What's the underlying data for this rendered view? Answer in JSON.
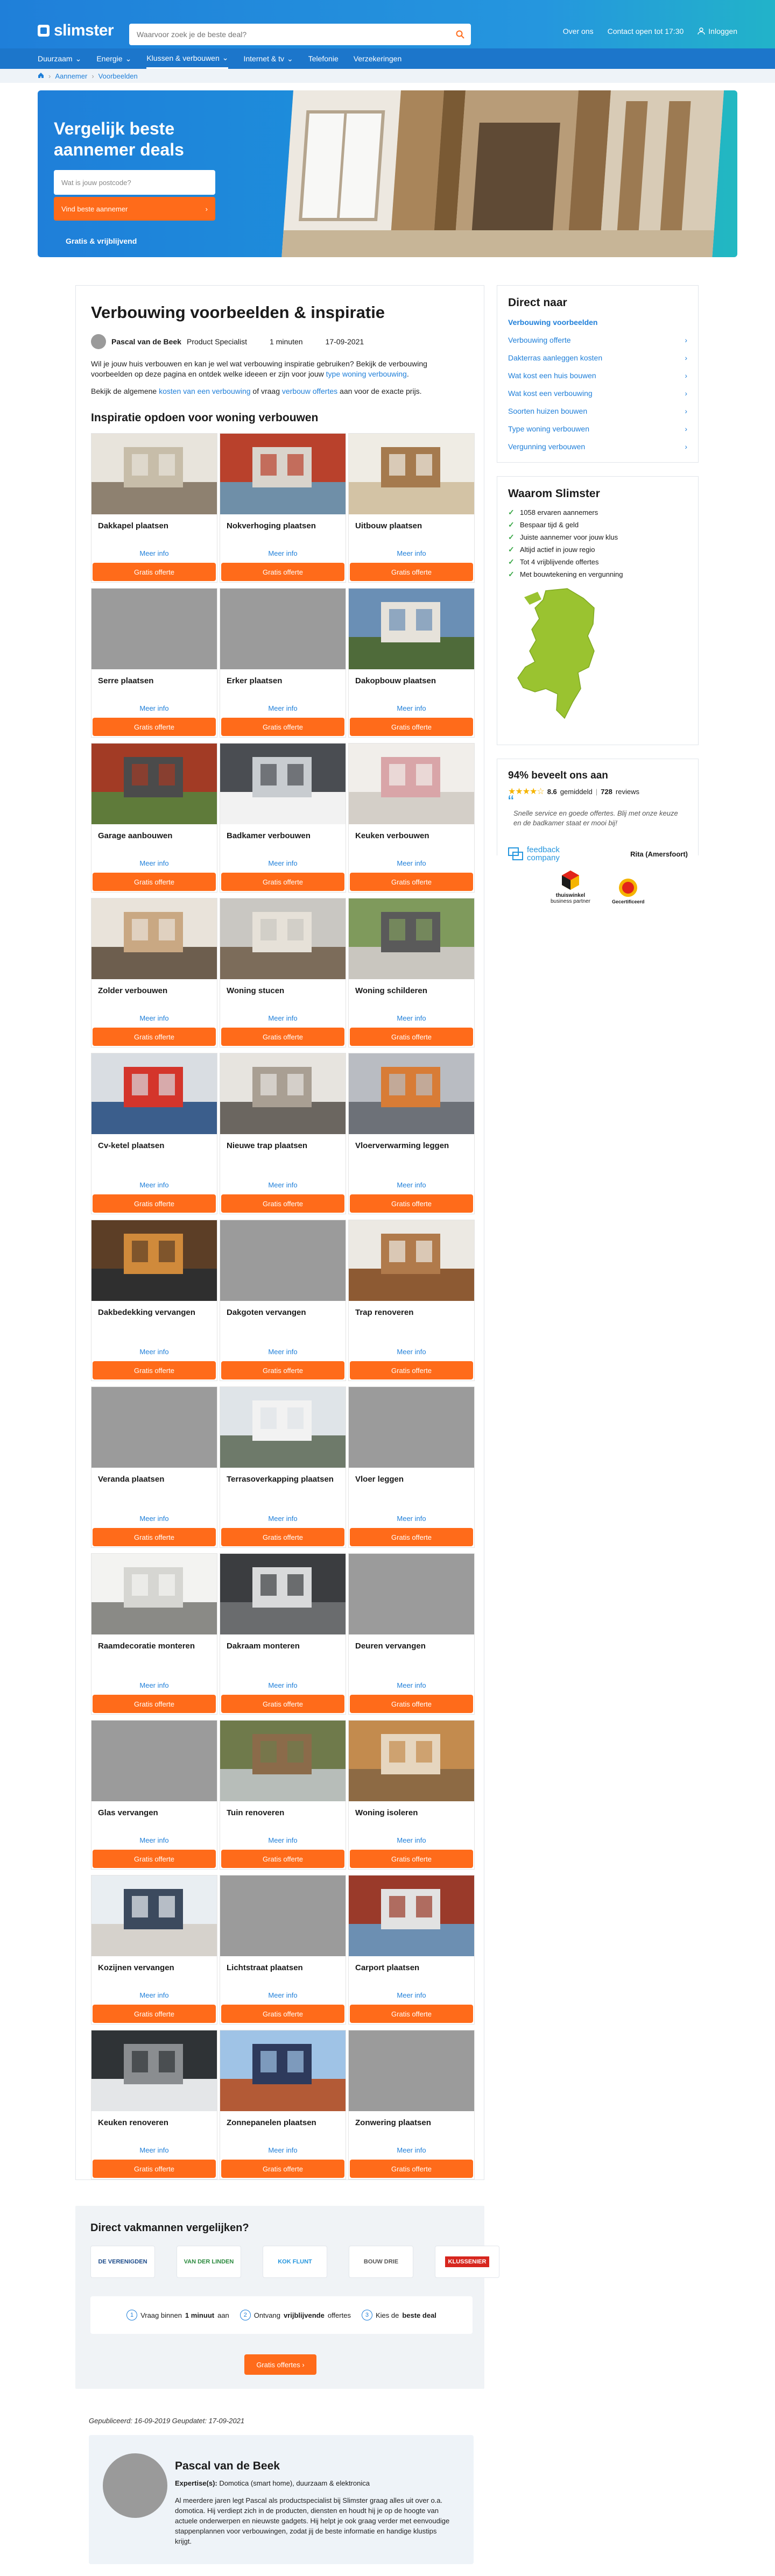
{
  "header": {
    "logo": "slimster",
    "search_placeholder": "Waarvoor zoek je de beste deal?",
    "links": [
      "Over ons",
      "Contact open tot 17:30",
      "Inloggen"
    ],
    "nav": [
      "Duurzaam",
      "Energie",
      "Klussen & verbouwen",
      "Internet & tv",
      "Telefonie",
      "Verzekeringen"
    ],
    "breadcrumb": [
      "Aannemer",
      "Voorbeelden"
    ]
  },
  "hero": {
    "title": "Vergelijk beste aannemer deals",
    "input_placeholder": "Wat is jouw postcode?",
    "button": "Vind beste aannemer",
    "note": "Gratis & vrijblijvend"
  },
  "article": {
    "title": "Verbouwing voorbeelden & inspiratie",
    "author_name": "Pascal van de Beek",
    "author_role": "Product Specialist",
    "read_time": "1 minuten",
    "date": "17-09-2021",
    "intro_before": "Wil je jouw huis verbouwen en kan je wel wat verbouwing inspiratie gebruiken? Bekijk de verbouwing voorbeelden op deze pagina en ontdek welke ideeen er zijn voor jouw ",
    "intro_link": "type woning verbouwing",
    "intro_after": ".",
    "intro2_a": "Bekijk de algemene ",
    "intro2_link1": "kosten van een verbouwing",
    "intro2_b": " of vraag ",
    "intro2_link2": "verbouw offertes",
    "intro2_c": " aan voor de exacte prijs.",
    "section_title": "Inspiratie opdoen voor woning verbouwen",
    "more_label": "Meer info",
    "cta_label": "Gratis offerte"
  },
  "cards": [
    {
      "title": "Dakkapel plaatsen",
      "img": "photo"
    },
    {
      "title": "Nokverhoging plaatsen",
      "img": "photo"
    },
    {
      "title": "Uitbouw plaatsen",
      "img": "photo"
    },
    {
      "title": "Serre plaatsen",
      "img": "grey"
    },
    {
      "title": "Erker plaatsen",
      "img": "grey"
    },
    {
      "title": "Dakopbouw plaatsen",
      "img": "photo"
    },
    {
      "title": "Garage aanbouwen",
      "img": "photo"
    },
    {
      "title": "Badkamer verbouwen",
      "img": "photo"
    },
    {
      "title": "Keuken verbouwen",
      "img": "photo"
    },
    {
      "title": "Zolder verbouwen",
      "img": "photo"
    },
    {
      "title": "Woning stucen",
      "img": "photo"
    },
    {
      "title": "Woning schilderen",
      "img": "photo"
    },
    {
      "title": "Cv-ketel plaatsen",
      "img": "photo"
    },
    {
      "title": "Nieuwe trap plaatsen",
      "img": "photo"
    },
    {
      "title": "Vloerverwarming leggen",
      "img": "photo"
    },
    {
      "title": "Dakbedekking vervangen",
      "img": "photo"
    },
    {
      "title": "Dakgoten vervangen",
      "img": "grey"
    },
    {
      "title": "Trap renoveren",
      "img": "photo"
    },
    {
      "title": "Veranda plaatsen",
      "img": "grey"
    },
    {
      "title": "Terrasoverkapping plaatsen",
      "img": "photo"
    },
    {
      "title": "Vloer leggen",
      "img": "grey"
    },
    {
      "title": "Raamdecoratie monteren",
      "img": "photo"
    },
    {
      "title": "Dakraam monteren",
      "img": "photo"
    },
    {
      "title": "Deuren vervangen",
      "img": "grey"
    },
    {
      "title": "Glas vervangen",
      "img": "grey"
    },
    {
      "title": "Tuin renoveren",
      "img": "photo"
    },
    {
      "title": "Woning isoleren",
      "img": "photo"
    },
    {
      "title": "Kozijnen vervangen",
      "img": "photo"
    },
    {
      "title": "Lichtstraat plaatsen",
      "img": "grey"
    },
    {
      "title": "Carport plaatsen",
      "img": "photo"
    },
    {
      "title": "Keuken renoveren",
      "img": "photo"
    },
    {
      "title": "Zonnepanelen plaatsen",
      "img": "photo"
    },
    {
      "title": "Zonwering plaatsen",
      "img": "grey"
    }
  ],
  "sidebar": {
    "direct_title": "Direct naar",
    "direct_items": [
      "Verbouwing voorbeelden",
      "Verbouwing offerte",
      "Dakterras aanleggen kosten",
      "Wat kost een huis bouwen",
      "Wat kost een verbouwing",
      "Soorten huizen bouwen",
      "Type woning verbouwen",
      "Vergunning verbouwen"
    ],
    "why_title": "Waarom Slimster",
    "usps": [
      "1058 ervaren aannemers",
      "Bespaar tijd & geld",
      "Juiste aannemer voor jouw klus",
      "Altijd actief in jouw regio",
      "Tot 4 vrijblijvende offertes",
      "Met bouwtekening en vergunning"
    ],
    "rec_title": "94% beveelt ons aan",
    "rating": "8.6",
    "rating_label": "gemiddeld",
    "reviews": "728",
    "reviews_label": "reviews",
    "quote": "Snelle service en goede offertes. Blij met onze keuze en de badkamer staat er mooi bij!",
    "fb_name": "feedback company",
    "reviewer": "Rita (Amersfoort)",
    "tw_name": "thuiswinkel",
    "tw_sub": "business partner",
    "cert": "Gecertificeerd"
  },
  "compare": {
    "title": "Direct vakmannen vergelijken?",
    "logos": [
      "DE VERENIGDEN",
      "VAN DER LINDEN",
      "KOK FLUNT",
      "BOUW DRIE",
      "KLUSSENIER"
    ],
    "steps": [
      {
        "num": "1",
        "pre": "Vraag binnen ",
        "bold": "1 minuut",
        "post": " aan"
      },
      {
        "num": "2",
        "pre": "Ontvang ",
        "bold": "vrijblijvende",
        "post": " offertes"
      },
      {
        "num": "3",
        "pre": "Kies de ",
        "bold": "beste deal",
        "post": ""
      }
    ],
    "button": "Gratis offertes"
  },
  "footer": {
    "published": "Gepubliceerd: 16-09-2019  Geupdatet: 17-09-2021",
    "author_name": "Pascal van de Beek",
    "expertise_label": "Expertise(s):",
    "expertise": " Domotica (smart home), duurzaam & elektronica",
    "bio": "Al meerdere jaren legt Pascal als productspecialist bij Slimster graag alles uit over o.a. domotica. Hij verdiept zich in de producten, diensten en houdt hij je op de hoogte van actuele onderwerpen en nieuwste gadgets. Hij helpt je ook graag verder met eenvoudige stappenplannen voor verbouwingen, zodat jij de beste informatie en handige klustips krijgt."
  }
}
